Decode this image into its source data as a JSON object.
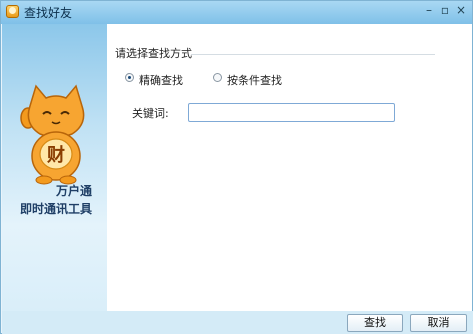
{
  "window": {
    "title": "查找好友"
  },
  "sidebar": {
    "brand_line1": "万户通",
    "brand_line2": "即时通讯工具",
    "mascot_char": "财"
  },
  "search": {
    "section_title": "请选择查找方式",
    "options": [
      {
        "label": "精确查找",
        "selected": true
      },
      {
        "label": "按条件查找",
        "selected": false
      }
    ],
    "keyword_label": "关键词:",
    "keyword_value": ""
  },
  "buttons": {
    "find": "查找",
    "cancel": "取消"
  },
  "colors": {
    "accent": "#7fc0e8",
    "mascot_orange": "#f39a1e"
  }
}
